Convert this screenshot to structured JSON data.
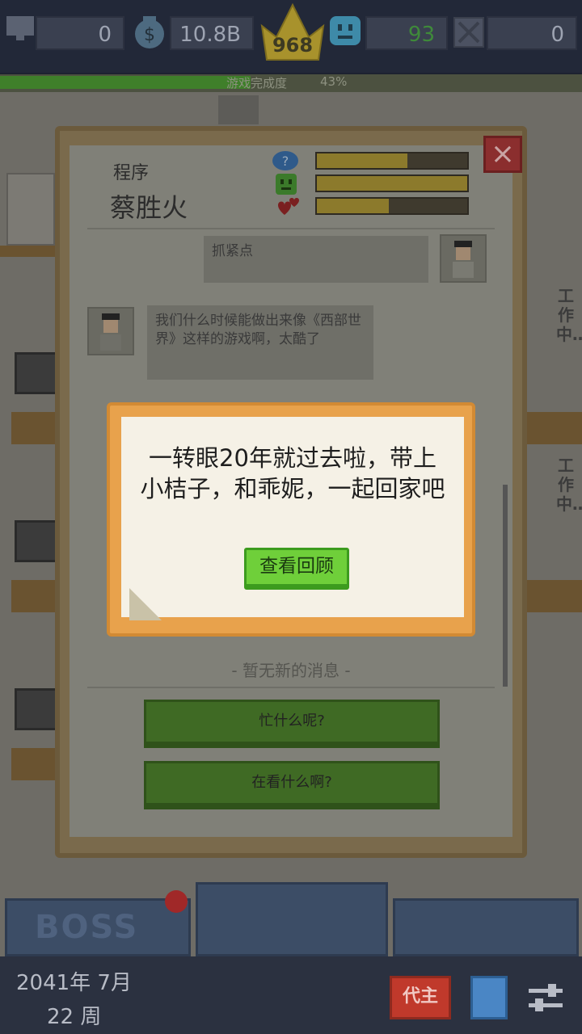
{
  "stats": {
    "employees": "0",
    "money": "10.8B",
    "crown_level": "968",
    "happiness": "93",
    "fails": "0"
  },
  "progress": {
    "label": "游戏完成度",
    "percent_text": "43%",
    "value": 0.43
  },
  "chat": {
    "role": "程序",
    "name": "蔡胜火",
    "bars": [
      {
        "icon": "question-icon",
        "value": 0.6
      },
      {
        "icon": "smile-face-icon",
        "value": 1.0
      },
      {
        "icon": "hearts-icon",
        "value": 0.48
      }
    ],
    "messages": [
      {
        "side": "right",
        "text": "抓紧点"
      },
      {
        "side": "left",
        "text": "我们什么时候能做出来像《西部世界》这样的游戏啊，太酷了"
      }
    ],
    "no_messages": "- 暂无新的消息 -",
    "replies": [
      "忙什么呢?",
      "在看什么啊?"
    ]
  },
  "dialog": {
    "text": "一转眼20年就过去啦，带上小桔子，和乖妮，一起回家吧",
    "button": "查看回顾"
  },
  "office": {
    "status_text": "工作中……"
  },
  "bottom_tabs": [
    "BOSS",
    "",
    ""
  ],
  "footer": {
    "date_line1": "2041年 7月",
    "date_line2": "22 周",
    "boss_button": "代主"
  },
  "colors": {
    "dialog_frame": "#e8a24c",
    "dialog_button": "#6fcf3a",
    "progress_fill": "#3f7f2a",
    "close_button": "#8b2e2e"
  }
}
